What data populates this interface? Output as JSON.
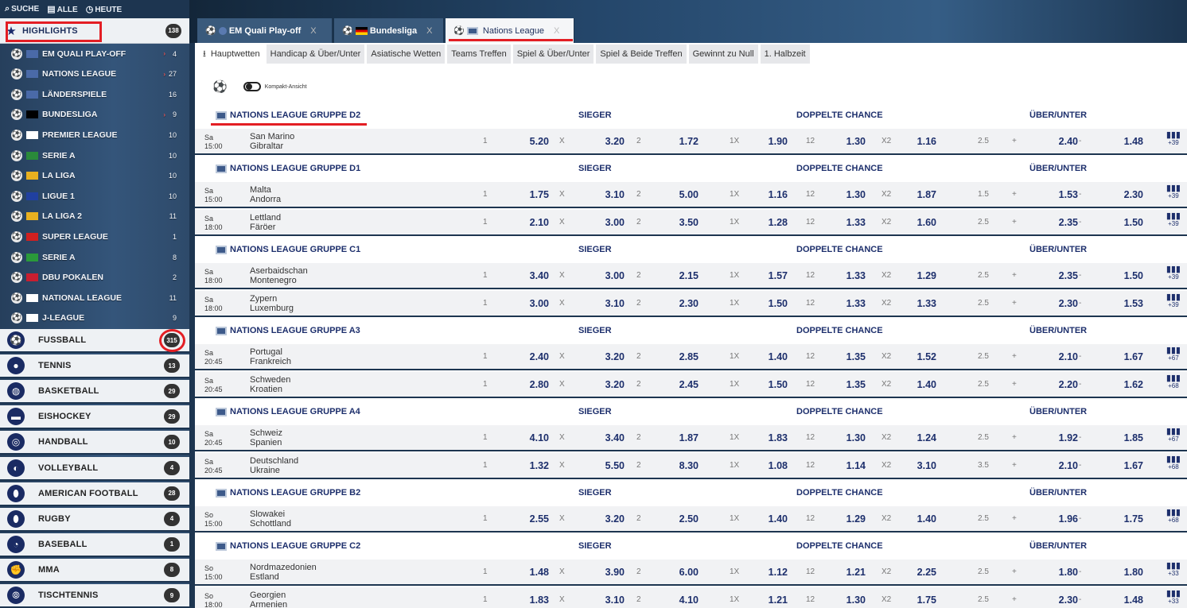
{
  "topbar": {
    "search": "SUCHE",
    "all": "ALLE",
    "today": "HEUTE"
  },
  "sidebar": {
    "highlights": {
      "label": "HIGHLIGHTS",
      "count": "138"
    },
    "leagues": [
      {
        "label": "EM QUALI PLAY-OFF",
        "count": "4",
        "flag": "#4a6aa8",
        "arrow": "›"
      },
      {
        "label": "NATIONS LEAGUE",
        "count": "27",
        "flag": "#4a6aa8",
        "arrow": "›"
      },
      {
        "label": "LÄNDERSPIELE",
        "count": "16",
        "flag": "#4a6aa8",
        "arrow": ""
      },
      {
        "label": "BUNDESLIGA",
        "count": "9",
        "flag": "#000000",
        "arrow": "›"
      },
      {
        "label": "PREMIER LEAGUE",
        "count": "10",
        "flag": "#ffffff",
        "arrow": ""
      },
      {
        "label": "SERIE A",
        "count": "10",
        "flag": "#2a8a3a",
        "arrow": ""
      },
      {
        "label": "LA LIGA",
        "count": "10",
        "flag": "#e8b020",
        "arrow": ""
      },
      {
        "label": "LIGUE 1",
        "count": "10",
        "flag": "#2040a0",
        "arrow": ""
      },
      {
        "label": "LA LIGA 2",
        "count": "11",
        "flag": "#e8b020",
        "arrow": ""
      },
      {
        "label": "SUPER LEAGUE",
        "count": "1",
        "flag": "#d02020",
        "arrow": ""
      },
      {
        "label": "SERIE A",
        "count": "8",
        "flag": "#2a9a3a",
        "arrow": ""
      },
      {
        "label": "DBU POKALEN",
        "count": "2",
        "flag": "#c81e30",
        "arrow": ""
      },
      {
        "label": "NATIONAL LEAGUE",
        "count": "11",
        "flag": "#ffffff",
        "arrow": ""
      },
      {
        "label": "J-LEAGUE",
        "count": "9",
        "flag": "#ffffff",
        "arrow": ""
      }
    ],
    "sports": [
      {
        "label": "FUSSBALL",
        "count": "315",
        "icon": "⚽"
      },
      {
        "label": "TENNIS",
        "count": "13",
        "icon": "●"
      },
      {
        "label": "BASKETBALL",
        "count": "29",
        "icon": "◍"
      },
      {
        "label": "EISHOCKEY",
        "count": "29",
        "icon": "▬"
      },
      {
        "label": "HANDBALL",
        "count": "10",
        "icon": "◎"
      },
      {
        "label": "VOLLEYBALL",
        "count": "4",
        "icon": "◐"
      },
      {
        "label": "AMERICAN FOOTBALL",
        "count": "28",
        "icon": "⬮"
      },
      {
        "label": "RUGBY",
        "count": "4",
        "icon": "⬮"
      },
      {
        "label": "BASEBALL",
        "count": "1",
        "icon": "◔"
      },
      {
        "label": "MMA",
        "count": "8",
        "icon": "✊"
      },
      {
        "label": "TISCHTENNIS",
        "count": "9",
        "icon": "⦾"
      }
    ]
  },
  "tabs": [
    {
      "label": "EM Quali Play-off",
      "x": "X"
    },
    {
      "label": "Bundesliga",
      "x": "X"
    },
    {
      "label": "Nations League",
      "x": "X"
    }
  ],
  "subtabs": [
    "Hauptwetten",
    "Handicap & Über/Unter",
    "Asiatische Wetten",
    "Teams Treffen",
    "Spiel & Über/Unter",
    "Spiel & Beide Treffen",
    "Gewinnt zu Null",
    "1. Halbzeit"
  ],
  "compact_label": "Kompakt-Ansicht",
  "col_labels": {
    "sieger": "SIEGER",
    "dc": "DOPPELTE CHANCE",
    "ou": "ÜBER/UNTER"
  },
  "market_labels": {
    "l1": "1",
    "lx": "X",
    "l2": "2",
    "l1x": "1X",
    "l12": "12",
    "lx2": "X2",
    "plus": "+",
    "minus": "-"
  },
  "groups": [
    {
      "name": "NATIONS LEAGUE GRUPPE D2",
      "matches": [
        {
          "day": "Sa",
          "time": "15:00",
          "home": "San Marino",
          "away": "Gibraltar",
          "o1": "5.20",
          "ox": "3.20",
          "o2": "1.72",
          "o1x": "1.90",
          "o12": "1.30",
          "ox2": "1.16",
          "line": "2.5",
          "over": "2.40",
          "under": "1.48",
          "more": "+39"
        }
      ]
    },
    {
      "name": "NATIONS LEAGUE GRUPPE D1",
      "matches": [
        {
          "day": "Sa",
          "time": "15:00",
          "home": "Malta",
          "away": "Andorra",
          "o1": "1.75",
          "ox": "3.10",
          "o2": "5.00",
          "o1x": "1.16",
          "o12": "1.30",
          "ox2": "1.87",
          "line": "1.5",
          "over": "1.53",
          "under": "2.30",
          "more": "+39"
        },
        {
          "day": "Sa",
          "time": "18:00",
          "home": "Lettland",
          "away": "Färöer",
          "o1": "2.10",
          "ox": "3.00",
          "o2": "3.50",
          "o1x": "1.28",
          "o12": "1.33",
          "ox2": "1.60",
          "line": "2.5",
          "over": "2.35",
          "under": "1.50",
          "more": "+39"
        }
      ]
    },
    {
      "name": "NATIONS LEAGUE GRUPPE C1",
      "matches": [
        {
          "day": "Sa",
          "time": "18:00",
          "home": "Aserbaidschan",
          "away": "Montenegro",
          "o1": "3.40",
          "ox": "3.00",
          "o2": "2.15",
          "o1x": "1.57",
          "o12": "1.33",
          "ox2": "1.29",
          "line": "2.5",
          "over": "2.35",
          "under": "1.50",
          "more": "+39"
        },
        {
          "day": "Sa",
          "time": "18:00",
          "home": "Zypern",
          "away": "Luxemburg",
          "o1": "3.00",
          "ox": "3.10",
          "o2": "2.30",
          "o1x": "1.50",
          "o12": "1.33",
          "ox2": "1.33",
          "line": "2.5",
          "over": "2.30",
          "under": "1.53",
          "more": "+39"
        }
      ]
    },
    {
      "name": "NATIONS LEAGUE GRUPPE A3",
      "matches": [
        {
          "day": "Sa",
          "time": "20:45",
          "home": "Portugal",
          "away": "Frankreich",
          "o1": "2.40",
          "ox": "3.20",
          "o2": "2.85",
          "o1x": "1.40",
          "o12": "1.35",
          "ox2": "1.52",
          "line": "2.5",
          "over": "2.10",
          "under": "1.67",
          "more": "+67"
        },
        {
          "day": "Sa",
          "time": "20:45",
          "home": "Schweden",
          "away": "Kroatien",
          "o1": "2.80",
          "ox": "3.20",
          "o2": "2.45",
          "o1x": "1.50",
          "o12": "1.35",
          "ox2": "1.40",
          "line": "2.5",
          "over": "2.20",
          "under": "1.62",
          "more": "+68"
        }
      ]
    },
    {
      "name": "NATIONS LEAGUE GRUPPE A4",
      "matches": [
        {
          "day": "Sa",
          "time": "20:45",
          "home": "Schweiz",
          "away": "Spanien",
          "o1": "4.10",
          "ox": "3.40",
          "o2": "1.87",
          "o1x": "1.83",
          "o12": "1.30",
          "ox2": "1.24",
          "line": "2.5",
          "over": "1.92",
          "under": "1.85",
          "more": "+67"
        },
        {
          "day": "Sa",
          "time": "20:45",
          "home": "Deutschland",
          "away": "Ukraine",
          "o1": "1.32",
          "ox": "5.50",
          "o2": "8.30",
          "o1x": "1.08",
          "o12": "1.14",
          "ox2": "3.10",
          "line": "3.5",
          "over": "2.10",
          "under": "1.67",
          "more": "+68"
        }
      ]
    },
    {
      "name": "NATIONS LEAGUE GRUPPE B2",
      "matches": [
        {
          "day": "So",
          "time": "15:00",
          "home": "Slowakei",
          "away": "Schottland",
          "o1": "2.55",
          "ox": "3.20",
          "o2": "2.50",
          "o1x": "1.40",
          "o12": "1.29",
          "ox2": "1.40",
          "line": "2.5",
          "over": "1.96",
          "under": "1.75",
          "more": "+68"
        }
      ]
    },
    {
      "name": "NATIONS LEAGUE GRUPPE C2",
      "matches": [
        {
          "day": "So",
          "time": "15:00",
          "home": "Nordmazedonien",
          "away": "Estland",
          "o1": "1.48",
          "ox": "3.90",
          "o2": "6.00",
          "o1x": "1.12",
          "o12": "1.21",
          "ox2": "2.25",
          "line": "2.5",
          "over": "1.80",
          "under": "1.80",
          "more": "+33"
        },
        {
          "day": "So",
          "time": "18:00",
          "home": "Georgien",
          "away": "Armenien",
          "o1": "1.83",
          "ox": "3.10",
          "o2": "4.10",
          "o1x": "1.21",
          "o12": "1.30",
          "ox2": "1.75",
          "line": "2.5",
          "over": "2.30",
          "under": "1.48",
          "more": "+33"
        }
      ]
    }
  ]
}
